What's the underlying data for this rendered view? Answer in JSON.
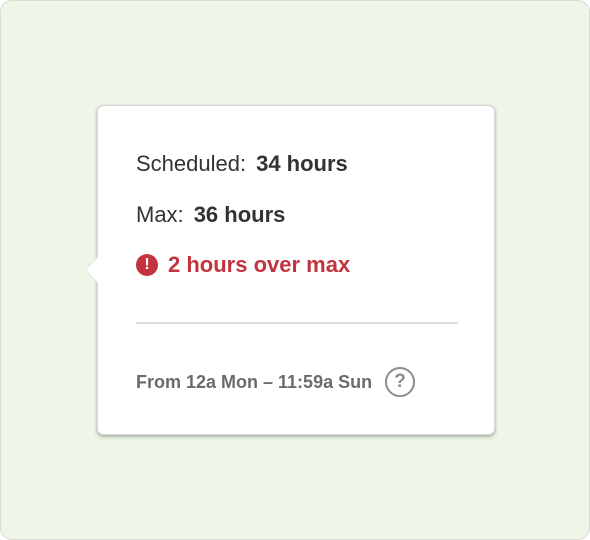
{
  "tooltip": {
    "scheduled_label": "Scheduled:",
    "scheduled_value": "34 hours",
    "max_label": "Max:",
    "max_value": "36 hours",
    "warning_text": "2 hours over max",
    "range_text": "From 12a Mon – 11:59a Sun",
    "help_glyph": "?",
    "warning_glyph": "!"
  },
  "icons": {
    "warning": "exclamation-circle-icon",
    "help": "question-circle-icon"
  },
  "colors": {
    "background": "#edf6e7",
    "warning": "#c3333e",
    "text": "#333333",
    "muted": "#6b6b6b"
  }
}
